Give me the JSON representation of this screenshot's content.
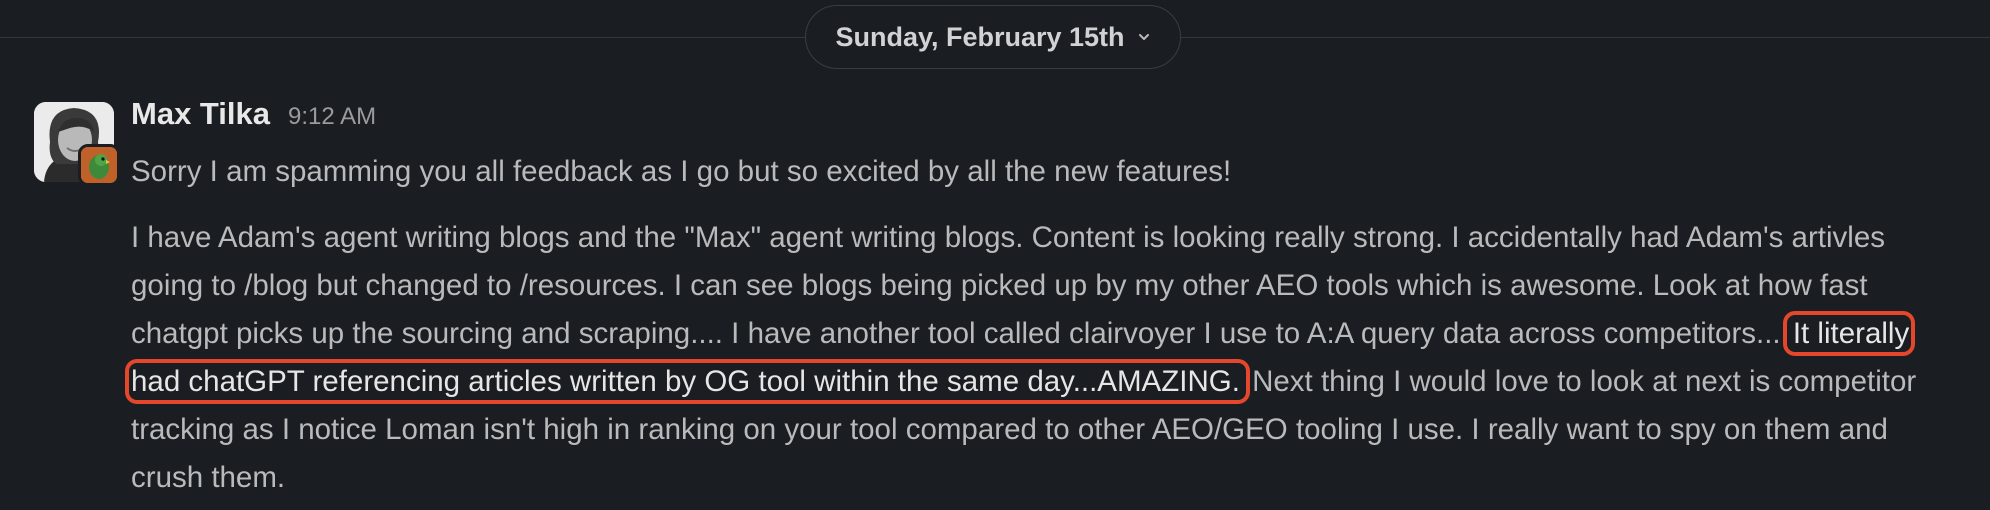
{
  "date_divider": {
    "label": "Sunday, February 15th",
    "icon": "chevron-down-icon"
  },
  "message": {
    "author": "Max Tilka",
    "timestamp": "9:12 AM",
    "first_line": "Sorry I am spamming you all feedback as I go but so excited by all the new features!",
    "para_before": "I have Adam's agent writing blogs and the \"Max\" agent writing blogs. Content is looking really strong. I accidentally had Adam's artivles going to /blog but changed to /resources. I can see blogs being picked up by my other AEO tools which is awesome. Look at how fast chatgpt picks up the sourcing and scraping.... I have another tool called clairvoyer I use to A:A query data across competitors...",
    "para_highlight": "It literally had chatGPT referencing articles written by OG tool within the same day...AMAZING.",
    "para_after": "Next thing I would love to look at next is competitor tracking as I notice Loman isn't high in ranking on your tool compared to other AEO/GEO tooling I use. I really want to spy on them and crush them."
  },
  "colors": {
    "background": "#1a1d21",
    "highlight_border": "#e4472c",
    "text": "#b9babc"
  }
}
